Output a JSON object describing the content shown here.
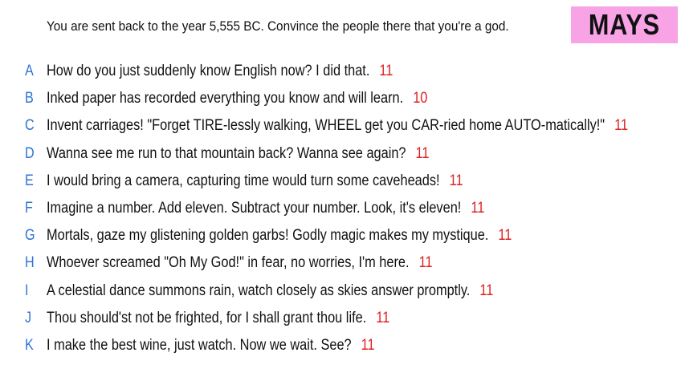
{
  "prompt": "You are sent back to the year 5,555 BC. Convince the people there that you're a god.",
  "name": "MAYS",
  "colors": {
    "letter": "#2f73d6",
    "score": "#e02020",
    "name_box": "#f7a3e6"
  },
  "answers": [
    {
      "letter": "A",
      "text": "How do you just suddenly know English now? I did that.",
      "score": "11"
    },
    {
      "letter": "B",
      "text": "Inked paper has recorded everything you know and will learn.",
      "score": "10"
    },
    {
      "letter": "C",
      "text": "Invent carriages! \"Forget TIRE-lessly walking, WHEEL get you CAR-ried home AUTO-matically!\"",
      "score": "11"
    },
    {
      "letter": "D",
      "text": "Wanna see me run to that mountain back? Wanna see again?",
      "score": "11"
    },
    {
      "letter": "E",
      "text": "I would bring a camera, capturing time would turn some caveheads!",
      "score": "11"
    },
    {
      "letter": "F",
      "text": "Imagine a number. Add eleven. Subtract your number. Look, it's eleven!",
      "score": "11"
    },
    {
      "letter": "G",
      "text": "Mortals, gaze my glistening golden garbs! Godly magic makes my mystique.",
      "score": "11"
    },
    {
      "letter": "H",
      "text": "Whoever screamed \"Oh My God!\" in fear, no worries, I'm here.",
      "score": "11"
    },
    {
      "letter": "I",
      "text": "A celestial dance summons rain, watch closely as skies answer promptly.",
      "score": "11"
    },
    {
      "letter": "J",
      "text": "Thou should'st not be frighted, for I shall grant thou life.",
      "score": "11"
    },
    {
      "letter": "K",
      "text": "I make the best wine, just watch. Now we wait. See?",
      "score": "11"
    }
  ]
}
